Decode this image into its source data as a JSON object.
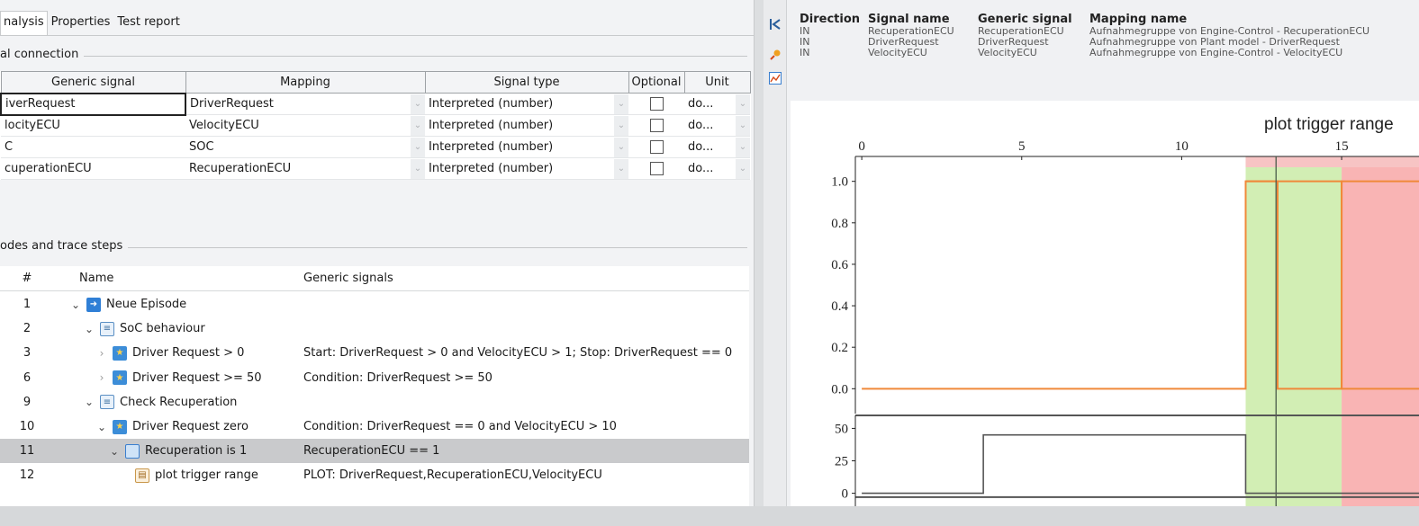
{
  "tabs": [
    {
      "label": "nalysis",
      "active": true
    },
    {
      "label": "Properties",
      "active": false
    },
    {
      "label": "Test report",
      "active": false
    }
  ],
  "signal_connection": {
    "title": "al connection",
    "columns": [
      "Generic signal",
      "Mapping",
      "Signal type",
      "Optional",
      "Unit"
    ],
    "rows": [
      {
        "generic": "iverRequest",
        "mapping": "DriverRequest",
        "type": "Interpreted (number)",
        "unit": "do..."
      },
      {
        "generic": "locityECU",
        "mapping": "VelocityECU",
        "type": "Interpreted (number)",
        "unit": "do..."
      },
      {
        "generic": "C",
        "mapping": "SOC",
        "type": "Interpreted (number)",
        "unit": "do..."
      },
      {
        "generic": "cuperationECU",
        "mapping": "RecuperationECU",
        "type": "Interpreted (number)",
        "unit": "do..."
      }
    ]
  },
  "trace": {
    "title": "odes and trace steps",
    "columns": {
      "num": "#",
      "name": "Name",
      "generic": "Generic signals"
    },
    "rows": [
      {
        "num": "1",
        "name": "Neue Episode",
        "generic": ""
      },
      {
        "num": "2",
        "name": "SoC behaviour",
        "generic": ""
      },
      {
        "num": "3",
        "name": "Driver Request > 0",
        "generic": "Start: DriverRequest > 0 and VelocityECU > 1; Stop: DriverRequest == 0"
      },
      {
        "num": "6",
        "name": "Driver Request >= 50",
        "generic": "Condition: DriverRequest >= 50"
      },
      {
        "num": "9",
        "name": "Check Recuperation",
        "generic": ""
      },
      {
        "num": "10",
        "name": "Driver Request zero",
        "generic": "Condition: DriverRequest == 0 and VelocityECU > 10"
      },
      {
        "num": "11",
        "name": "Recuperation is 1",
        "generic": "RecuperationECU == 1"
      },
      {
        "num": "12",
        "name": "plot trigger range",
        "generic": "PLOT: DriverRequest,RecuperationECU,VelocityECU"
      }
    ]
  },
  "signal_info": {
    "headers": {
      "direction": "Direction",
      "signal": "Signal name",
      "generic": "Generic signal",
      "mapping": "Mapping name"
    },
    "rows": [
      {
        "direction": "IN",
        "signal": "RecuperationECU",
        "generic": "RecuperationECU",
        "mapping": "Aufnahmegruppe von Engine-Control - RecuperationECU"
      },
      {
        "direction": "IN",
        "signal": "DriverRequest",
        "generic": "DriverRequest",
        "mapping": "Aufnahmegruppe von Plant model - DriverRequest"
      },
      {
        "direction": "IN",
        "signal": "VelocityECU",
        "generic": "VelocityECU",
        "mapping": "Aufnahmegruppe von Engine-Control - VelocityECU"
      }
    ]
  },
  "toolbar_icons": [
    "collapse-left-icon",
    "pin-icon",
    "chart-icon"
  ],
  "chart_data": {
    "type": "line",
    "title": "plot trigger range",
    "x_ticks": [
      0,
      5,
      10,
      15
    ],
    "xlim": [
      -0.2,
      17.7
    ],
    "upper": {
      "ylim": [
        -0.12,
        1.12
      ],
      "y_ticks": [
        "0.0",
        "0.2",
        "0.4",
        "0.6",
        "0.8",
        "1.0"
      ],
      "series": [
        {
          "color": "#f0893a",
          "x": [
            0,
            12.0,
            12.0,
            13.0,
            13.0,
            15.0,
            15.0,
            17.7
          ],
          "y": [
            0,
            0,
            1,
            1,
            0,
            0,
            1,
            1
          ]
        },
        {
          "color": "#f0893a",
          "x": [
            12.0,
            15.0,
            15.0,
            17.7
          ],
          "y": [
            1,
            1,
            0,
            0
          ]
        }
      ],
      "regions": [
        {
          "from": 12.0,
          "to": 15.0,
          "color": "#d2eeb4"
        },
        {
          "from": 15.0,
          "to": 17.7,
          "color": "#f9b4b4"
        }
      ]
    },
    "lower": {
      "ylim": [
        -10,
        60
      ],
      "y_ticks": [
        "0",
        "25",
        "50"
      ],
      "series": [
        {
          "color": "#555555",
          "x": [
            0,
            3.8,
            3.8,
            12.0,
            12.0,
            17.7
          ],
          "y": [
            0,
            0,
            45,
            45,
            0,
            0
          ]
        }
      ]
    }
  },
  "colors": {
    "selection": "#c9cacc",
    "accent_orange": "#f0893a",
    "green_region": "#d2eeb4",
    "red_region": "#f9b4b4"
  }
}
